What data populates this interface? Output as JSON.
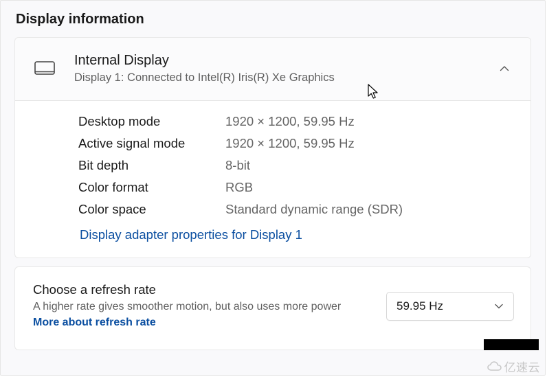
{
  "section_title": "Display information",
  "display": {
    "name": "Internal Display",
    "subtitle": "Display 1: Connected to Intel(R) Iris(R) Xe Graphics",
    "details": [
      {
        "label": "Desktop mode",
        "value": "1920 × 1200, 59.95 Hz"
      },
      {
        "label": "Active signal mode",
        "value": "1920 × 1200, 59.95 Hz"
      },
      {
        "label": "Bit depth",
        "value": "8-bit"
      },
      {
        "label": "Color format",
        "value": "RGB"
      },
      {
        "label": "Color space",
        "value": "Standard dynamic range (SDR)"
      }
    ],
    "adapter_link": "Display adapter properties for Display 1"
  },
  "refresh": {
    "title": "Choose a refresh rate",
    "description_prefix": "A higher rate gives smoother motion, but also uses more power  ",
    "more_link": "More about refresh rate",
    "selected": "59.95 Hz"
  },
  "watermark": "亿速云"
}
